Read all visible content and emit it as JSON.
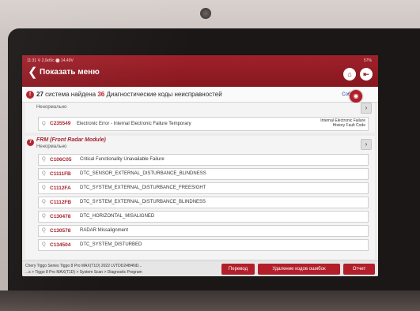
{
  "statusbar": {
    "left": "11:31  ⚲  2,0кб/с  ⬤  14,49V",
    "right": "57%"
  },
  "header": {
    "title": "Показать меню",
    "home_icon": "home-icon",
    "exit_icon": "exit-icon"
  },
  "summary": {
    "systems_count": "27",
    "text_part1": " система найдена ",
    "codes_count": "36",
    "text_part2": " Диагностические коды неисправностей",
    "collect_label": "Собират"
  },
  "modules": [
    {
      "name": "",
      "status": "Ненормально",
      "codes": [
        {
          "code": "C235549",
          "description": "Electronic Error - Internal Electronic Failure Temporary",
          "status_line1": "Internal Electronic Failure",
          "status_line2": "History Fault Code"
        }
      ]
    },
    {
      "index": "7",
      "name": "FRM (Front Radar Module)",
      "status": "Ненормально",
      "codes": [
        {
          "code": "C106C05",
          "description": "Critical Functionality Unavailable Failure"
        },
        {
          "code": "C1111FB",
          "description": "DTC_SENSOR_EXTERNAL_DISTURBANCE_BLINDNESS"
        },
        {
          "code": "C1112FA",
          "description": "DTC_SYSTEM_EXTERNAL_DISTURBANCE_FREESIGHT"
        },
        {
          "code": "C1112FB",
          "description": "DTC_SYSTEM_EXTERNAL_DISTURBANCE_BLINDNESS"
        },
        {
          "code": "C130478",
          "description": "DTC_HORIZONTAL_MISALIGNED"
        },
        {
          "code": "C130578",
          "description": "RADAR Missalignment"
        },
        {
          "code": "C134504",
          "description": "DTC_SYSTEM_DISTURBED"
        }
      ]
    }
  ],
  "footer": {
    "vehicle_line": "Chery  Tiggo Series Tiggo 8 Pro MAX(T1D) 2022  LVTDD24B4ND...",
    "path_line": "...s > Tiggo 8 Pro MAX(T1D) > System Scan > Diagnostic Program",
    "translate_btn": "Перевод",
    "clear_btn": "Удаление кодов ошибок",
    "report_btn": "Отчет"
  },
  "colors": {
    "accent": "#a3202a",
    "header": "#901b23"
  }
}
